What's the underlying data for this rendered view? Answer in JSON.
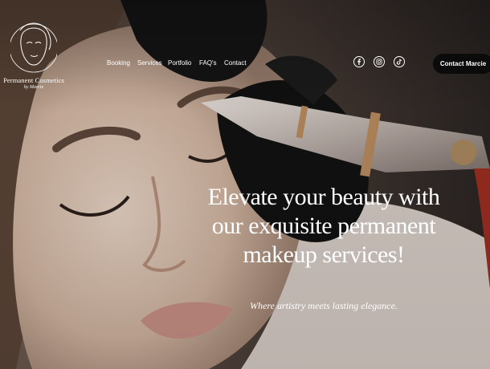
{
  "logo": {
    "brand": "Permanent Cosmetics",
    "sub": "by Marcie"
  },
  "nav": {
    "items": [
      "Booking",
      "Services",
      "Portfolio",
      "FAQ's",
      "Contact"
    ]
  },
  "social": [
    "facebook-icon",
    "instagram-icon",
    "tiktok-icon"
  ],
  "cta": {
    "label": "Contact Marcie"
  },
  "hero": {
    "headline": "Elevate your beauty with our exquisite permanent makeup services!",
    "tagline": "Where artistry meets lasting elegance."
  },
  "colors": {
    "cta_bg": "#0b0b0b",
    "text": "#ffffff",
    "skin": "#d8c4b4",
    "glove": "#151515"
  }
}
